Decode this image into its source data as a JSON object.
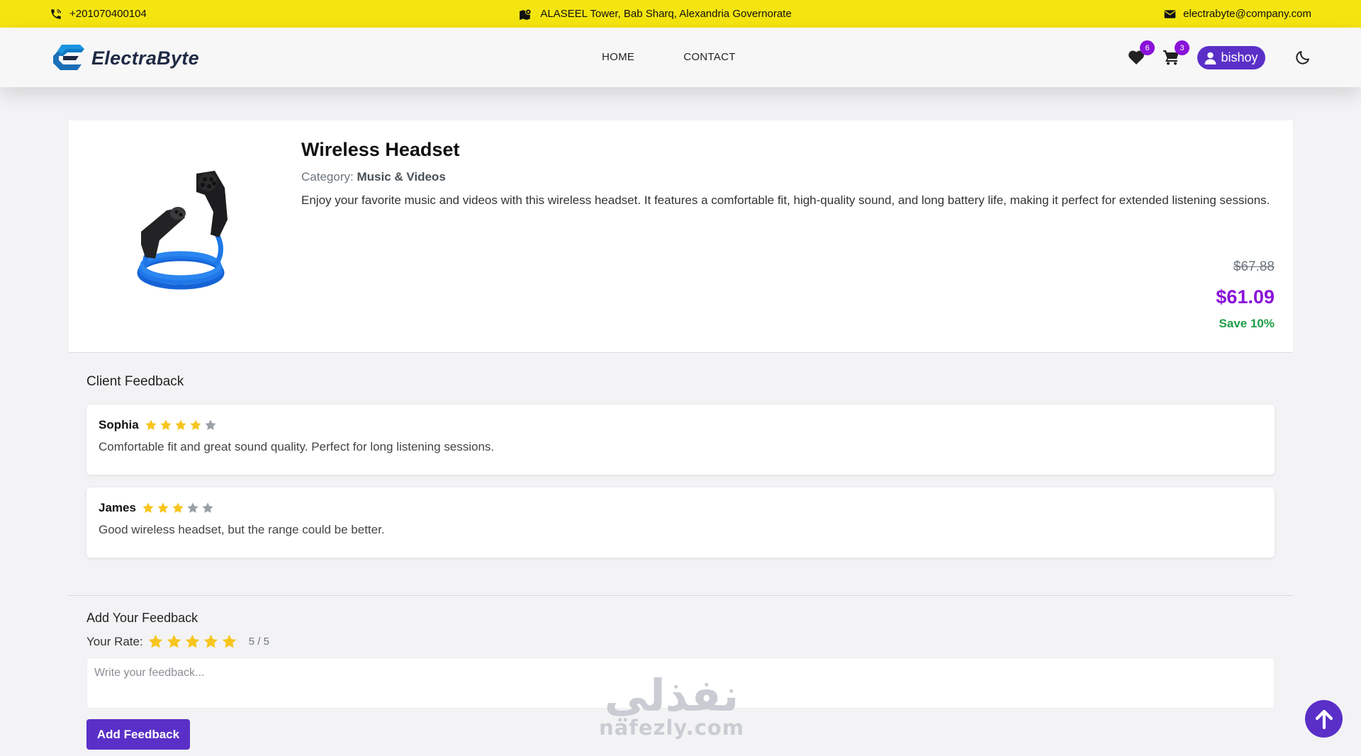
{
  "topbar": {
    "phone": "+201070400104",
    "address": "ALASEEL Tower, Bab Sharq, Alexandria Governorate",
    "email": "electrabyte@company.com"
  },
  "nav": {
    "brand": "ElectraByte",
    "links": [
      "HOME",
      "CONTACT"
    ],
    "wishlist_count": "6",
    "cart_count": "3",
    "user_name": "bishoy"
  },
  "product": {
    "title": "Wireless Headset",
    "category_label": "Category:",
    "category": "Music & Videos",
    "description": "Enjoy your favorite music and videos with this wireless headset. It features a comfortable fit, high-quality sound, and long battery life, making it perfect for extended listening sessions.",
    "old_price": "$67.88",
    "price": "$61.09",
    "save": "Save 10%"
  },
  "feedback": {
    "title": "Client Feedback",
    "reviews": [
      {
        "name": "Sophia",
        "rating": 4,
        "text": "Comfortable fit and great sound quality. Perfect for long listening sessions."
      },
      {
        "name": "James",
        "rating": 3,
        "text": "Good wireless headset, but the range could be better."
      }
    ]
  },
  "add_feedback": {
    "title": "Add Your Feedback",
    "rate_label": "Your Rate:",
    "rating": 5,
    "rate_text": "5 / 5",
    "placeholder": "Write your feedback...",
    "button": "Add Feedback"
  },
  "watermark": {
    "arabic": "نفذلي",
    "latin": "nafezly.com"
  },
  "colors": {
    "topbar": "#f5e50f",
    "accent": "#5a2fc8",
    "price": "#8a12d9",
    "save": "#1f9d47",
    "star": "#f7c51e",
    "star_empty": "#9aa0a6"
  }
}
